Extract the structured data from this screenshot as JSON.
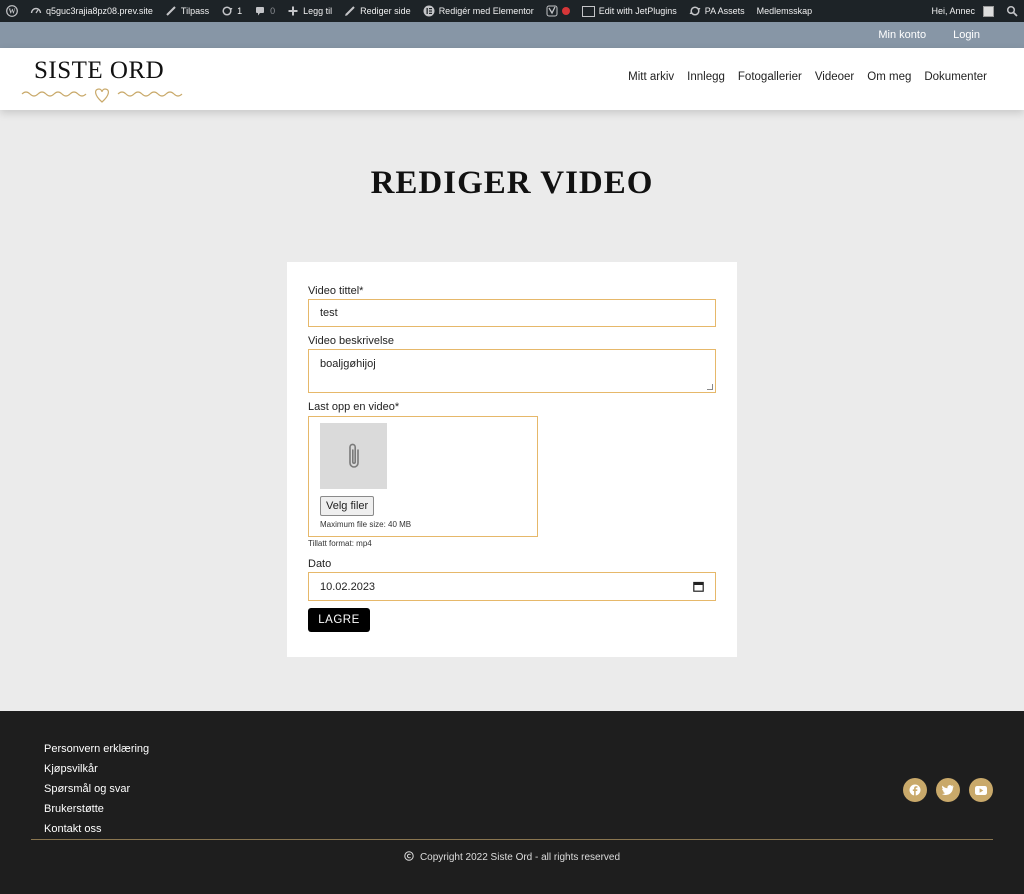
{
  "admin_bar": {
    "site": "q5guc3rajia8pz08.prev.site",
    "customize": "Tilpass",
    "updates_count": "1",
    "comments_count": "0",
    "add_new": "Legg til",
    "edit_page": "Rediger side",
    "edit_elementor": "Redigér med Elementor",
    "edit_jet": "Edit with JetPlugins",
    "pa_assets": "PA Assets",
    "membership": "Medlemsskap",
    "greeting": "Hei, Annec"
  },
  "account_bar": {
    "my_account": "Min konto",
    "login": "Login"
  },
  "header": {
    "logo_text": "SISTE ORD",
    "nav": [
      "Mitt arkiv",
      "Innlegg",
      "Fotogallerier",
      "Videoer",
      "Om meg",
      "Dokumenter"
    ]
  },
  "page_title": "REDIGER VIDEO",
  "form": {
    "title_label": "Video tittel*",
    "title_value": "test",
    "desc_label": "Video beskrivelse",
    "desc_value": "boaljgøhijoj",
    "upload_label": "Last opp en video*",
    "choose_button": "Velg filer",
    "max_size": "Maximum file size: 40 MB",
    "allowed_format": "Tillatt format: mp4",
    "date_label": "Dato",
    "date_value": "10.02.2023",
    "save_button": "LAGRE"
  },
  "footer": {
    "links": [
      "Personvern erklæring",
      "Kjøpsvilkår",
      "Spørsmål og svar",
      "Brukerstøtte",
      "Kontakt oss"
    ],
    "copyright": "Copyright 2022 Siste Ord - all rights reserved",
    "social_icons": [
      "facebook-icon",
      "twitter-icon",
      "youtube-icon"
    ],
    "accent_color": "#c9a96a"
  }
}
